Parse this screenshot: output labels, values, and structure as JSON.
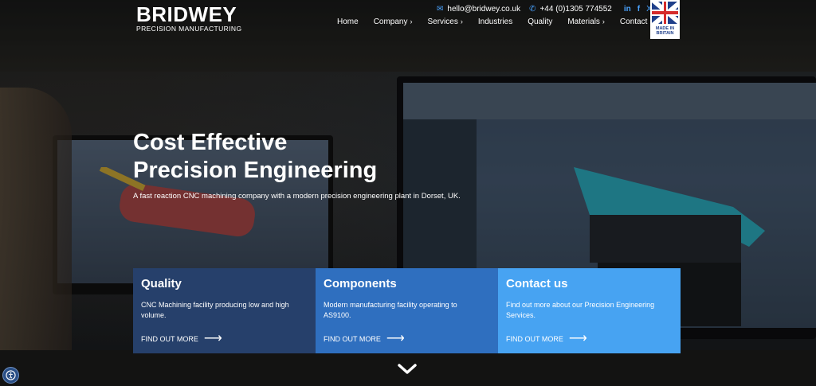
{
  "brand": {
    "name": "BRIDWEY",
    "tagline": "PRECISION MANUFACTURING"
  },
  "contact": {
    "email": "hello@bridwey.co.uk",
    "phone": "+44 (0)1305 774552",
    "email_icon": "envelope-icon",
    "phone_icon": "phone-icon"
  },
  "social": [
    {
      "icon": "linkedin-icon",
      "label": "in"
    },
    {
      "icon": "facebook-icon",
      "label": "f"
    },
    {
      "icon": "x-icon",
      "label": "X"
    }
  ],
  "nav": {
    "items": [
      {
        "label": "Home",
        "has_submenu": false
      },
      {
        "label": "Company",
        "has_submenu": true
      },
      {
        "label": "Services",
        "has_submenu": true
      },
      {
        "label": "Industries",
        "has_submenu": false
      },
      {
        "label": "Quality",
        "has_submenu": false
      },
      {
        "label": "Materials",
        "has_submenu": true
      },
      {
        "label": "Contact",
        "has_submenu": false
      }
    ]
  },
  "badge": {
    "text_line1": "MADE IN",
    "text_line2": "BRITAIN"
  },
  "hero": {
    "title_line1": "Cost Effective",
    "title_line2": "Precision Engineering",
    "subtitle": "A fast reaction CNC machining company with a modern precision engineering plant in Dorset, UK."
  },
  "cards": [
    {
      "title": "Quality",
      "text": "CNC Machining facility producing low and high volume.",
      "cta": "FIND OUT MORE",
      "color": "#26406b"
    },
    {
      "title": "Components",
      "text": "Modern manufacturing facility operating to AS9100.",
      "cta": "FIND OUT MORE",
      "color": "#2f6fbf"
    },
    {
      "title": "Contact us",
      "text": "Find out more about our Precision Engineering Services.",
      "cta": "FIND OUT MORE",
      "color": "#47a3f2"
    }
  ],
  "colors": {
    "accent": "#4aa3ff"
  },
  "icons": {
    "scroll": "chevron-down-icon",
    "accessibility": "accessibility-icon",
    "arrow": "arrow-right-icon"
  }
}
